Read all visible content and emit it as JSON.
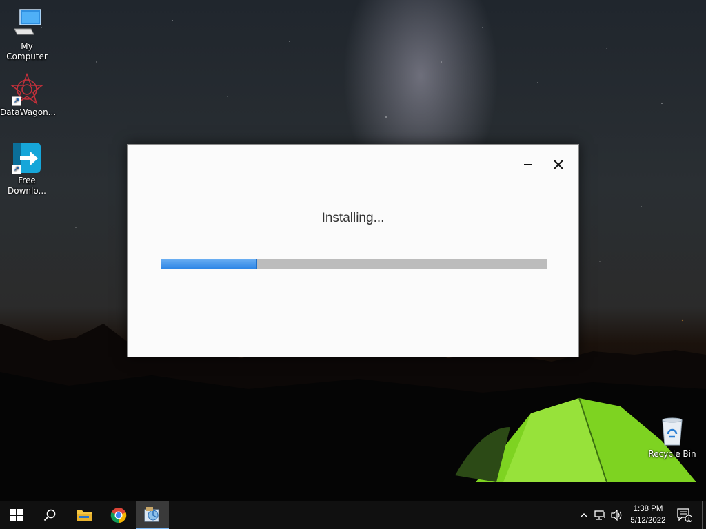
{
  "desktop": {
    "icons": [
      {
        "label": "My Computer"
      },
      {
        "label": "DataWagon..."
      },
      {
        "label": "Free Downlo..."
      },
      {
        "label": "Recycle Bin"
      }
    ]
  },
  "dialog": {
    "status_text": "Installing...",
    "progress_fraction": 0.25,
    "minimize_icon": "minimize-icon",
    "close_icon": "close-icon"
  },
  "taskbar": {
    "items": [
      "start-icon",
      "search-icon",
      "file-explorer-icon",
      "chrome-icon",
      "installer-icon"
    ],
    "tray": [
      "chevron-up-icon",
      "network-icon",
      "volume-icon",
      "notification-icon"
    ],
    "time": "1:38 PM",
    "date": "5/12/2022",
    "notification_count": "1"
  },
  "colors": {
    "progress_fill": "#2e86e6",
    "progress_track": "#bcbcbc",
    "taskbar": "#101010"
  }
}
